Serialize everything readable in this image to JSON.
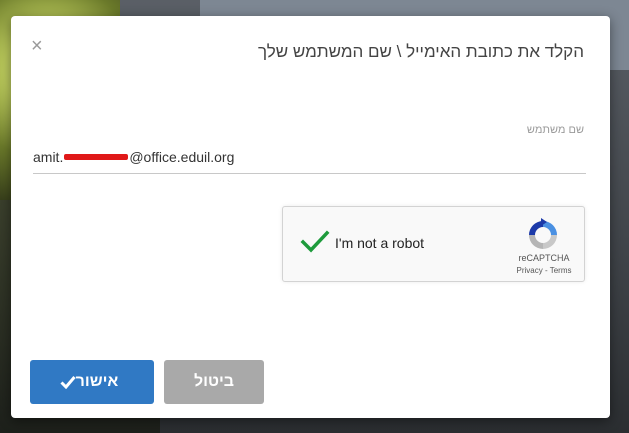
{
  "dialog": {
    "title": "הקלד את כתובת האימייל \\ שם המשתמש שלך",
    "close_icon": "×",
    "field": {
      "label": "שם משתמש",
      "value_prefix": "amit.",
      "value_suffix": "@office.eduil.org"
    },
    "captcha": {
      "label": "I'm not a robot",
      "brand": "reCAPTCHA",
      "links": "Privacy - Terms",
      "checked": true,
      "check_color": "#1e9b3c"
    },
    "buttons": {
      "confirm": "אישור",
      "cancel": "ביטול"
    },
    "colors": {
      "primary": "#3079c4",
      "secondary": "#a9a9a9"
    }
  }
}
